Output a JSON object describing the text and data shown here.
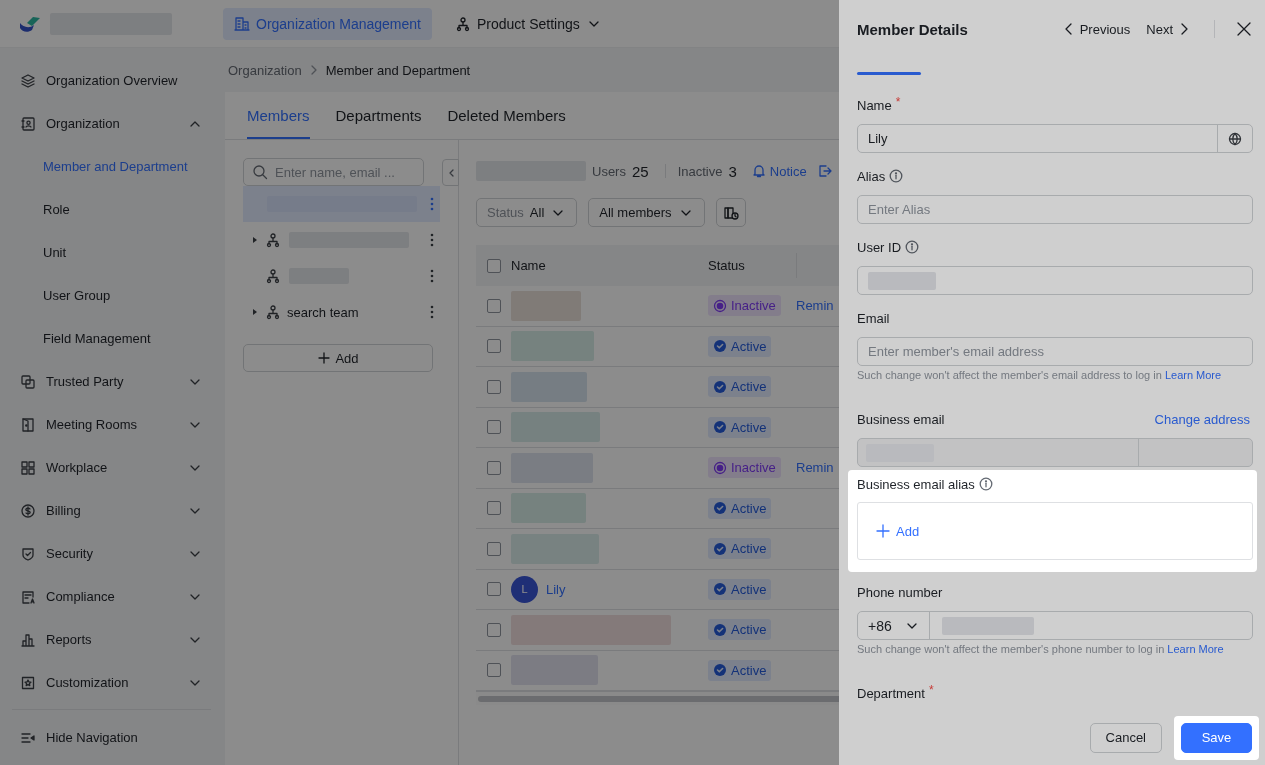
{
  "top_bar": {
    "logo_name_blurred": true,
    "nav_tabs": [
      {
        "label": "Organization Management",
        "selected": true,
        "dropdown": false
      },
      {
        "label": "Product Settings",
        "selected": false,
        "dropdown": true
      }
    ]
  },
  "sidebar": {
    "items": [
      {
        "label": "Organization Overview",
        "selected": false
      },
      {
        "label": "Organization",
        "selected": false,
        "expanded": true,
        "children": [
          {
            "label": "Member and Department",
            "selected": true
          },
          {
            "label": "Role",
            "selected": false
          },
          {
            "label": "Unit",
            "selected": false
          },
          {
            "label": "User Group",
            "selected": false
          },
          {
            "label": "Field Management",
            "selected": false
          }
        ]
      },
      {
        "label": "Trusted Party",
        "selected": false,
        "expanded": false
      },
      {
        "label": "Meeting Rooms",
        "selected": false,
        "expanded": false
      },
      {
        "label": "Workplace",
        "selected": false,
        "expanded": false
      },
      {
        "label": "Billing",
        "selected": false,
        "expanded": false
      },
      {
        "label": "Security",
        "selected": false,
        "expanded": false
      },
      {
        "label": "Compliance",
        "selected": false,
        "expanded": false
      },
      {
        "label": "Reports",
        "selected": false,
        "expanded": false
      },
      {
        "label": "Customization",
        "selected": false,
        "expanded": false
      }
    ],
    "footer": "Hide Navigation"
  },
  "breadcrumb": [
    "Organization",
    "Member and Department"
  ],
  "tabs": [
    {
      "label": "Members",
      "selected": true
    },
    {
      "label": "Departments",
      "selected": false
    },
    {
      "label": "Deleted Members",
      "selected": false
    }
  ],
  "department_tree": {
    "search": {
      "placeholder": "Enter name, email ..."
    },
    "nodes": [
      {
        "selected": true,
        "has_children": false,
        "name_blurred": true,
        "org_icon": false
      },
      {
        "selected": false,
        "has_children": true,
        "name_blurred": true,
        "org_icon": true
      },
      {
        "selected": false,
        "has_children": false,
        "name_blurred": true,
        "org_icon": true
      },
      {
        "selected": false,
        "has_children": true,
        "label": "search team",
        "org_icon": true
      }
    ],
    "add_button": "Add"
  },
  "members": {
    "org_name_blurred": true,
    "stats": [
      {
        "label": "Users",
        "value": "25"
      },
      {
        "label": "Inactive",
        "value": "3"
      }
    ],
    "links": [
      {
        "kind": "notice",
        "label": "Notice"
      },
      {
        "kind": "export"
      }
    ],
    "filters": [
      {
        "label": "Status",
        "value": "All"
      },
      {
        "value": "All members"
      }
    ],
    "columns": [
      "Name",
      "Status"
    ],
    "all_checked": false,
    "rows": [
      {
        "checked": false,
        "name_blurred": true,
        "status": {
          "label": "Inactive",
          "kind": "inactive"
        },
        "action": "Remin"
      },
      {
        "checked": false,
        "name_blurred": true,
        "status": {
          "label": "Active",
          "kind": "active"
        }
      },
      {
        "checked": false,
        "name_blurred": true,
        "status": {
          "label": "Active",
          "kind": "active"
        }
      },
      {
        "checked": false,
        "name_blurred": true,
        "status": {
          "label": "Active",
          "kind": "active"
        }
      },
      {
        "checked": false,
        "name_blurred": true,
        "status": {
          "label": "Inactive",
          "kind": "inactive"
        },
        "action": "Remin"
      },
      {
        "checked": false,
        "name_blurred": true,
        "status": {
          "label": "Active",
          "kind": "active"
        }
      },
      {
        "checked": false,
        "name_blurred": true,
        "status": {
          "label": "Active",
          "kind": "active"
        }
      },
      {
        "checked": false,
        "name": "Lily",
        "avatar_initial": "L",
        "status": {
          "label": "Active",
          "kind": "active"
        }
      },
      {
        "checked": false,
        "name_blurred": true,
        "status": {
          "label": "Active",
          "kind": "active"
        }
      },
      {
        "checked": false,
        "name_blurred": true,
        "status": {
          "label": "Active",
          "kind": "active"
        }
      }
    ]
  },
  "drawer": {
    "title": "Member Details",
    "previous": "Previous",
    "next": "Next",
    "fields": [
      {
        "kind": "addon",
        "label": "Name",
        "required_mark": "*",
        "value": "Lily",
        "highlighted": false
      },
      {
        "kind": "text",
        "label": "Alias",
        "info": true,
        "placeholder": "Enter Alias",
        "highlighted": false
      },
      {
        "kind": "text",
        "label": "User ID",
        "info": true,
        "value_blurred": true,
        "highlighted": false
      },
      {
        "kind": "text",
        "label": "Email",
        "placeholder": "Enter member's email address",
        "help": "Such change won't affect the member's email address to log in",
        "help_link": "Learn More",
        "highlighted": false
      },
      {
        "kind": "split",
        "label": "Business email",
        "link": "Change address",
        "value_blurred": true,
        "disabled": true,
        "highlighted": false
      },
      {
        "kind": "alias_list",
        "label": "Business email alias",
        "info": true,
        "add": "Add",
        "highlighted": true
      },
      {
        "kind": "phone",
        "label": "Phone number",
        "code": "+86",
        "value_blurred": true,
        "help": "Such change won't affect the member's phone number to log in",
        "help_link": "Learn More",
        "highlighted": false
      },
      {
        "kind": "label_only",
        "label": "Department",
        "required_mark": "*",
        "highlighted": false
      }
    ],
    "buttons": [
      {
        "label": "Cancel",
        "kind": "secondary",
        "highlighted": false
      },
      {
        "label": "Save",
        "kind": "primary",
        "highlighted": true
      }
    ]
  }
}
